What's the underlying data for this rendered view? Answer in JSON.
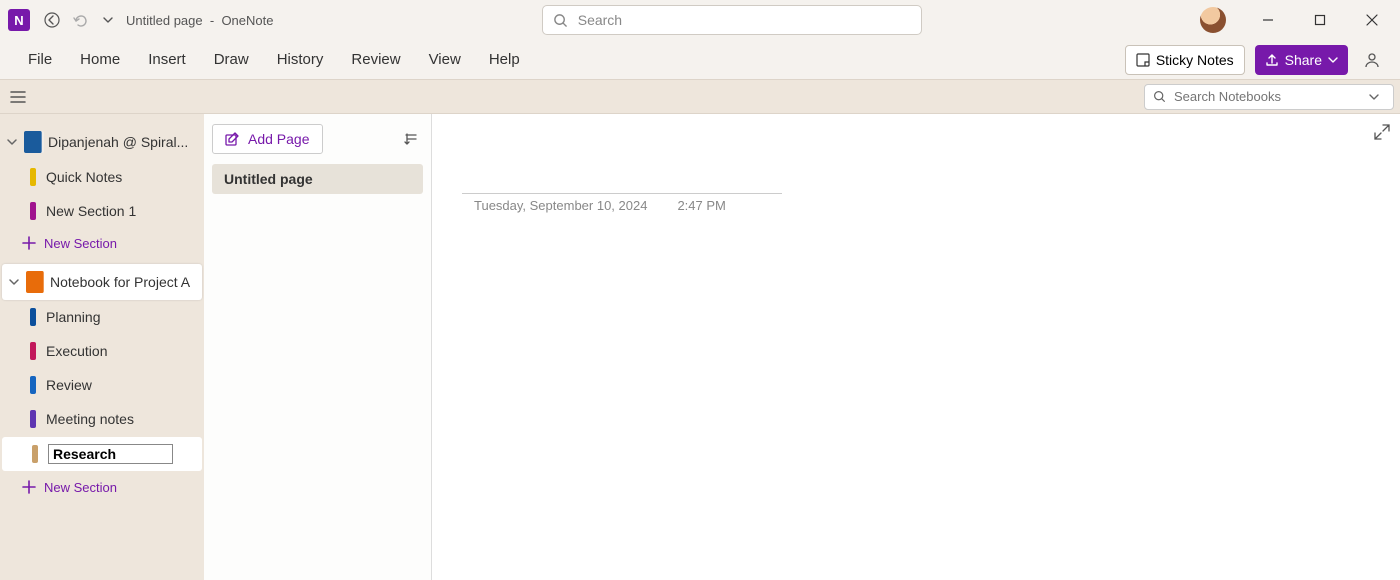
{
  "titlebar": {
    "app_badge": "N",
    "page_title": "Untitled page",
    "sep": "-",
    "app_name": "OneNote"
  },
  "search": {
    "placeholder": "Search"
  },
  "menubar": {
    "items": [
      "File",
      "Home",
      "Insert",
      "Draw",
      "History",
      "Review",
      "View",
      "Help"
    ],
    "sticky_notes": "Sticky Notes",
    "share": "Share"
  },
  "search_notebooks": {
    "placeholder": "Search Notebooks"
  },
  "sidebar": {
    "notebooks": [
      {
        "label": "Dipanjenah @ Spiral...",
        "color": "#1a5b9c",
        "sections": [
          {
            "label": "Quick Notes",
            "color": "#e6b800"
          },
          {
            "label": "New Section 1",
            "color": "#a0138e"
          }
        ]
      },
      {
        "label": "Notebook for Project A",
        "color": "#e86c0a",
        "selected": true,
        "sections": [
          {
            "label": "Planning",
            "color": "#0b4f9c"
          },
          {
            "label": "Execution",
            "color": "#c2185b"
          },
          {
            "label": "Review",
            "color": "#1565c0"
          },
          {
            "label": "Meeting notes",
            "color": "#5e35b1"
          },
          {
            "label": "Research",
            "color": "#c9a06a",
            "editing": true
          }
        ]
      }
    ],
    "new_section": "New Section"
  },
  "pagelist": {
    "add_page": "Add Page",
    "pages": [
      {
        "label": "Untitled page",
        "active": true
      }
    ]
  },
  "canvas": {
    "date": "Tuesday, September 10, 2024",
    "time": "2:47 PM"
  }
}
